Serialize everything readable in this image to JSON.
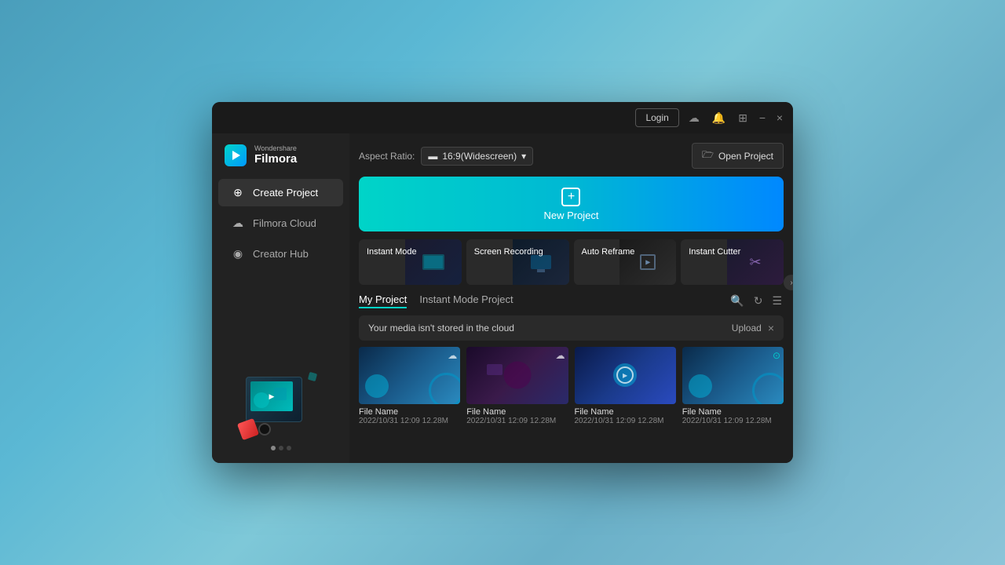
{
  "window": {
    "title": "Wondershare Filmora",
    "controls": {
      "login": "Login",
      "minimize": "−",
      "close": "×"
    }
  },
  "logo": {
    "brand": "Wondershare",
    "name": "Filmora"
  },
  "sidebar": {
    "nav": [
      {
        "id": "create-project",
        "label": "Create Project",
        "icon": "⊕",
        "active": true
      },
      {
        "id": "filmora-cloud",
        "label": "Filmora Cloud",
        "icon": "☁"
      },
      {
        "id": "creator-hub",
        "label": "Creator Hub",
        "icon": "◉"
      }
    ],
    "dots": [
      true,
      false,
      false
    ]
  },
  "content": {
    "aspect_ratio": {
      "label": "Aspect Ratio:",
      "value": "16:9(Widescreen)",
      "icon": "▬"
    },
    "open_project": {
      "label": "Open Project",
      "icon": "🗁"
    },
    "new_project": {
      "label": "New Project"
    },
    "quick_actions": [
      {
        "id": "instant-mode",
        "label": "Instant Mode"
      },
      {
        "id": "screen-recording",
        "label": "Screen Recording"
      },
      {
        "id": "auto-reframe",
        "label": "Auto Reframe"
      },
      {
        "id": "instant-cutter",
        "label": "Instant Cutter"
      }
    ],
    "my_project": {
      "tabs": [
        {
          "id": "my-project",
          "label": "My Project",
          "active": true
        },
        {
          "id": "instant-mode-project",
          "label": "Instant Mode Project",
          "active": false
        }
      ],
      "cloud_banner": {
        "text": "Your media isn't stored in the cloud",
        "upload": "Upload",
        "close": "×"
      },
      "files": [
        {
          "name": "File Name",
          "date": "2022/10/31",
          "time": "12:09",
          "size": "12.28M",
          "thumb": "1",
          "has_cloud": true,
          "has_play": false
        },
        {
          "name": "File Name",
          "date": "2022/10/31",
          "time": "12:09",
          "size": "12.28M",
          "thumb": "2",
          "has_cloud": true,
          "has_play": false
        },
        {
          "name": "File Name",
          "date": "2022/10/31",
          "time": "12:09",
          "size": "12.28M",
          "thumb": "3",
          "has_cloud": false,
          "has_play": true
        },
        {
          "name": "File Name",
          "date": "2022/10/31",
          "time": "12:09",
          "size": "12.28M",
          "thumb": "4",
          "has_cloud": true,
          "has_play": false
        }
      ]
    }
  }
}
